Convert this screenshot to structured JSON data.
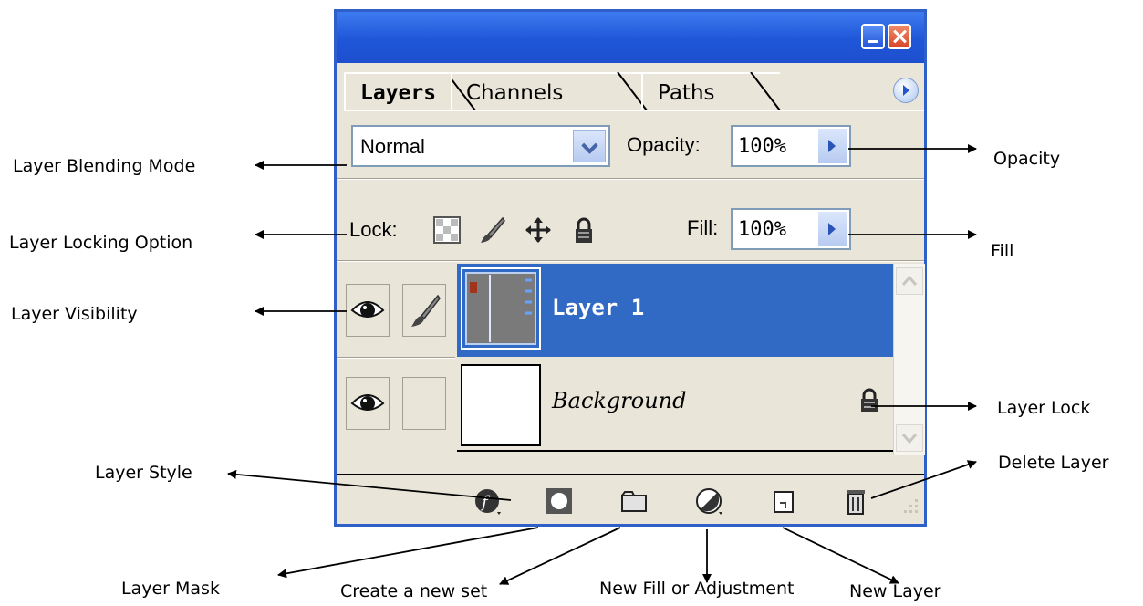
{
  "palette": {
    "tabs": [
      {
        "label": "Layers"
      },
      {
        "label": "Channels"
      },
      {
        "label": "Paths"
      }
    ],
    "blend_mode": "Normal",
    "opacity_label": "Opacity:",
    "opacity_value": "100%",
    "lock_label": "Lock:",
    "fill_label": "Fill:",
    "fill_value": "100%",
    "layers": [
      {
        "name": "Layer 1",
        "selected": true
      },
      {
        "name": "Background",
        "selected": false
      }
    ]
  },
  "annotations": {
    "blending_mode": "Layer Blending Mode",
    "locking_option": "Layer Locking Option",
    "visibility": "Layer Visibility",
    "layer_style": "Layer Style",
    "layer_mask": "Layer Mask",
    "new_set": "Create a new set",
    "new_fill": "New Fill or Adjustment",
    "new_layer": "New Layer",
    "opacity": "Opacity",
    "fill": "Fill",
    "layer_lock": "Layer Lock",
    "delete_layer": "Delete Layer"
  },
  "colors": {
    "titlebar": "#1f56d8",
    "panel": "#e9e5d9",
    "selection": "#316ac5"
  }
}
